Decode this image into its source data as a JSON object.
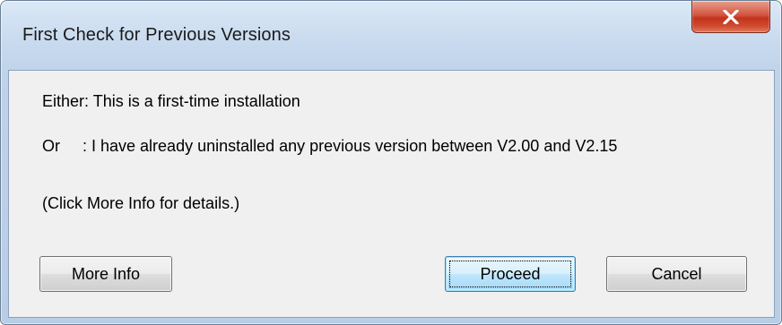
{
  "window": {
    "title": "First Check for Previous Versions",
    "close_icon": "close-icon"
  },
  "message": {
    "line1": "Either: This is a first-time installation",
    "line2": "Or     : I have already uninstalled any previous version between V2.00 and V2.15",
    "line3": "(Click More Info for details.)"
  },
  "buttons": {
    "more_info": "More Info",
    "proceed": "Proceed",
    "cancel": "Cancel"
  },
  "colors": {
    "close_button": "#c4331c",
    "default_button_border": "#3c7fb1",
    "client_background": "#f0f0f0"
  }
}
